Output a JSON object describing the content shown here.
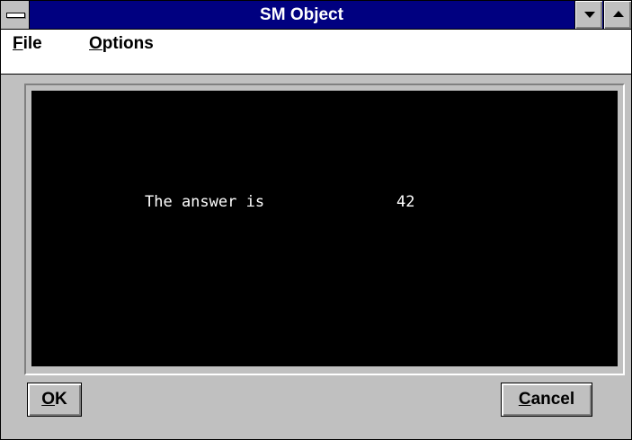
{
  "window": {
    "title": "SM Object"
  },
  "menu": {
    "items": [
      {
        "accel": "F",
        "rest": "ile",
        "label": "File"
      },
      {
        "accel": "O",
        "rest": "ptions",
        "label": "Options"
      }
    ]
  },
  "display": {
    "label": "The answer is",
    "value": "42"
  },
  "buttons": {
    "ok": {
      "accel": "O",
      "rest": "K",
      "label": "OK"
    },
    "cancel": {
      "accel": "C",
      "rest": "ancel",
      "label": "Cancel"
    }
  },
  "icons": {
    "system_menu": "system-menu-icon",
    "minimize": "minimize-arrow-icon",
    "maximize": "maximize-arrow-icon"
  },
  "colors": {
    "titlebar": "#000080",
    "face": "#c0c0c0",
    "display_bg": "#000000",
    "display_text": "#ffffff"
  }
}
